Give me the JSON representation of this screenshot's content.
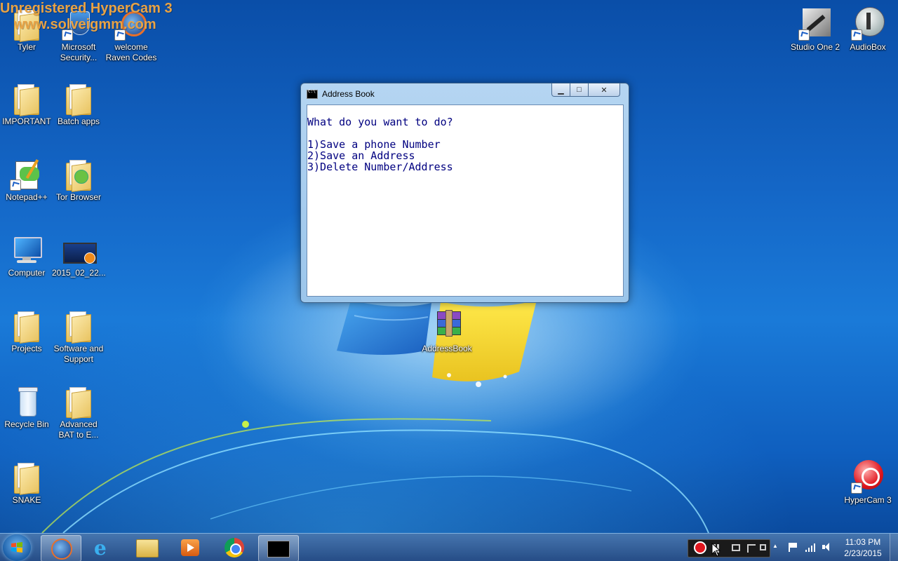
{
  "watermark": {
    "line1": "Unregistered HyperCam 3",
    "line2": "www.solveigmm.com"
  },
  "desktop_icons": {
    "tyler": "Tyler",
    "microsoft_security": "Microsoft Security...",
    "welcome": "welcome Raven Codes",
    "important": "IMPORTANT",
    "batch_apps": "Batch apps",
    "notepadpp": "Notepad++",
    "tor_browser": "Tor Browser",
    "computer": "Computer",
    "video_2015": "2015_02_22...",
    "projects": "Projects",
    "software_support": "Software and Support",
    "recycle_bin": "Recycle Bin",
    "advanced_bat": "Advanced BAT to E...",
    "snake": "SNAKE",
    "studio_one": "Studio One 2",
    "audiobox": "AudioBox",
    "addressbook": "AddressBook",
    "hypercam": "HyperCam 3"
  },
  "window": {
    "title": "Address Book",
    "minimize_glyph": "▁",
    "maximize_glyph": "□",
    "close_glyph": "✕",
    "console_lines": [
      "",
      "What do you want to do?",
      "",
      "1)Save a phone Number",
      "2)Save an Address",
      "3)Delete Number/Address"
    ]
  },
  "taskbar": {
    "clock_time": "11:03 PM",
    "clock_date": "2/23/2015",
    "tray_up_arrow": "▲"
  },
  "colors": {
    "console_text": "#000080",
    "watermark": "#e8a244",
    "taskbar": "#1e4682"
  }
}
